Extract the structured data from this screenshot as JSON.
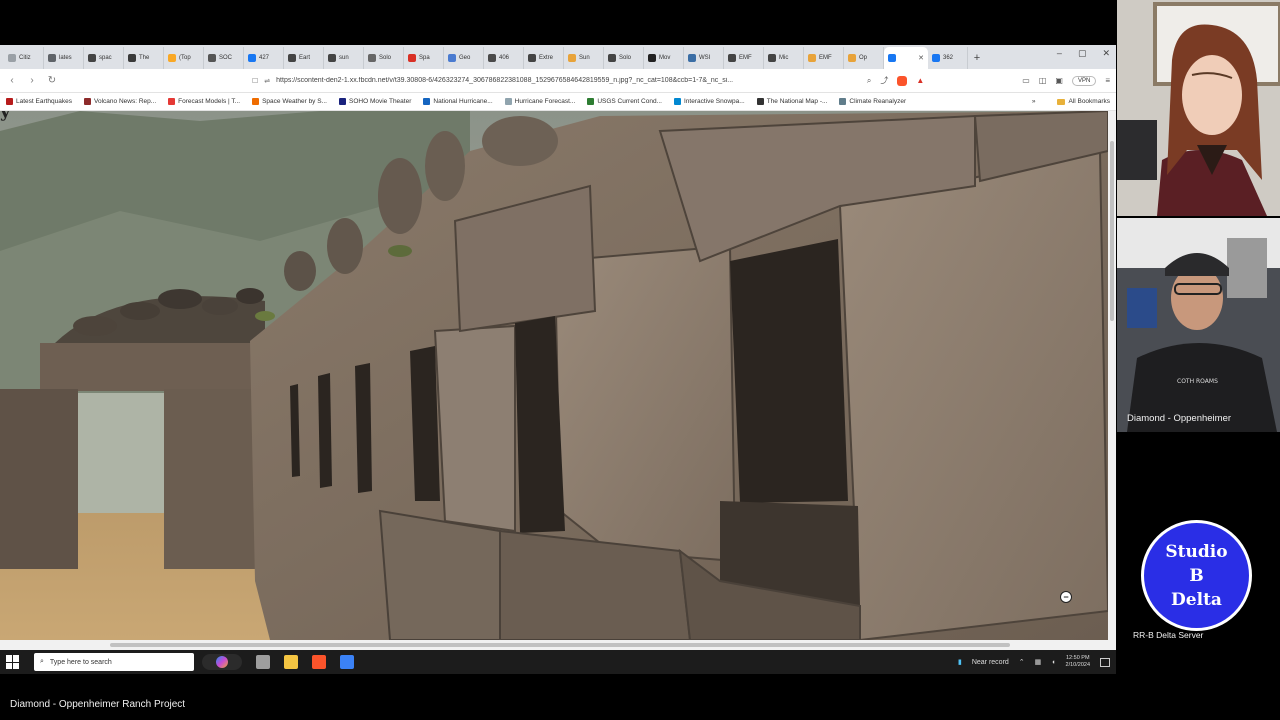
{
  "browser": {
    "tabs": [
      {
        "label": "Citiz",
        "color": "#9aa0a6"
      },
      {
        "label": "lates",
        "color": "#5f6368"
      },
      {
        "label": "spac",
        "color": "#444444"
      },
      {
        "label": "The",
        "color": "#3a3a3a"
      },
      {
        "label": "(Top",
        "color": "#f9a825"
      },
      {
        "label": "SOC",
        "color": "#555555"
      },
      {
        "label": "427",
        "color": "#1877f2"
      },
      {
        "label": "Eart",
        "color": "#444444"
      },
      {
        "label": "sun",
        "color": "#444444"
      },
      {
        "label": "Solo",
        "color": "#666666"
      },
      {
        "label": "Spa",
        "color": "#d93025"
      },
      {
        "label": "Geo",
        "color": "#4a7bd0"
      },
      {
        "label": "406",
        "color": "#4a4a4a"
      },
      {
        "label": "Extre",
        "color": "#444444"
      },
      {
        "label": "Sun",
        "color": "#e8a33a"
      },
      {
        "label": "Solo",
        "color": "#444444"
      },
      {
        "label": "Mov",
        "color": "#222222"
      },
      {
        "label": "WSI",
        "color": "#3b6ea5"
      },
      {
        "label": "EMF",
        "color": "#444444"
      },
      {
        "label": "Mic",
        "color": "#444444"
      },
      {
        "label": "EMF",
        "color": "#e8a33a"
      },
      {
        "label": "Op",
        "color": "#e8a33a"
      },
      {
        "label": "",
        "color": "#1877f2",
        "active": true
      },
      {
        "label": "362",
        "color": "#1877f2"
      }
    ],
    "new_tab": "+",
    "window_controls": {
      "minimize": "–",
      "restore": "▢",
      "close": "✕"
    },
    "url": "https://scontent-den2-1.xx.fbcdn.net/v/t39.30808-6/426323274_306786822381088_1529676584642819559_n.jpg?_nc_cat=108&ccb=1-7&_nc_si...",
    "vpn": "VPN",
    "bookmarks": [
      {
        "label": "Latest Earthquakes",
        "color": "#b71c1c"
      },
      {
        "label": "Volcano News: Rep...",
        "color": "#8d2b2b"
      },
      {
        "label": "Forecast Models | T...",
        "color": "#e53935"
      },
      {
        "label": "Space Weather by S...",
        "color": "#ef6c00"
      },
      {
        "label": "SOHO Movie Theater",
        "color": "#1a237e"
      },
      {
        "label": "National Hurricane...",
        "color": "#1565c0"
      },
      {
        "label": "Hurricane Forecast...",
        "color": "#90a4ae"
      },
      {
        "label": "USGS Current Cond...",
        "color": "#2e7d32"
      },
      {
        "label": "Interactive Snowpa...",
        "color": "#0288d1"
      },
      {
        "label": "The National Map -...",
        "color": "#333333"
      },
      {
        "label": "Climate Reanalyzer",
        "color": "#607d8b"
      }
    ],
    "bookmarks_more": "»",
    "all_bookmarks": "All Bookmarks",
    "zoom_out": "−"
  },
  "taskbar": {
    "search_placeholder": "Type here to search",
    "tray_status": "Near record",
    "time": "12:50 PM",
    "date": "2/10/2024",
    "apps": [
      {
        "name": "task-view",
        "color": "#9e9e9e"
      },
      {
        "name": "file-explorer",
        "color": "#f4c542"
      },
      {
        "name": "brave",
        "color": "#fb542b"
      },
      {
        "name": "streaming-app",
        "color": "#3b82f6"
      }
    ]
  },
  "cams": {
    "host_label": "Diamond - Oppenheimer"
  },
  "logo": {
    "line1": "Studio",
    "line2": "B",
    "line3": "Delta",
    "caption": "RR-B Delta Server",
    "color": "#2a2ee6"
  },
  "stream_title": "Diamond - Oppenheimer Ranch Project"
}
